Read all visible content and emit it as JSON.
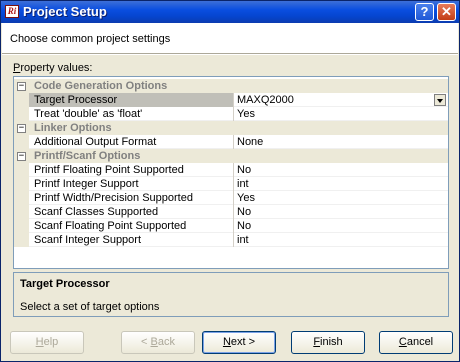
{
  "window": {
    "icon_text": "Ri",
    "title": "Project Setup",
    "help_glyph": "?",
    "close_glyph": "✕"
  },
  "subtitle": "Choose common project settings",
  "property_label": {
    "first": "P",
    "rest": "roperty values:"
  },
  "grid": {
    "categories": [
      {
        "name": "Code Generation Options",
        "toggle": "−",
        "props": [
          {
            "name": "Target Processor",
            "value": "MAXQ2000",
            "selected": true
          },
          {
            "name": "Treat 'double' as 'float'",
            "value": "Yes"
          }
        ]
      },
      {
        "name": "Linker Options",
        "toggle": "−",
        "props": [
          {
            "name": "Additional Output Format",
            "value": "None"
          }
        ]
      },
      {
        "name": "Printf/Scanf Options",
        "toggle": "−",
        "props": [
          {
            "name": "Printf Floating Point Supported",
            "value": "No"
          },
          {
            "name": "Printf Integer Support",
            "value": "int"
          },
          {
            "name": "Printf Width/Precision Supported",
            "value": "Yes"
          },
          {
            "name": "Scanf Classes Supported",
            "value": "No"
          },
          {
            "name": "Scanf Floating Point Supported",
            "value": "No"
          },
          {
            "name": "Scanf Integer Support",
            "value": "int"
          }
        ]
      }
    ]
  },
  "description": {
    "title": "Target Processor",
    "text": "Select a set of target options"
  },
  "buttons": {
    "help": {
      "mn": "H",
      "rest": "elp"
    },
    "back": {
      "pre": "< ",
      "mn": "B",
      "rest": "ack"
    },
    "next": {
      "mn": "N",
      "rest": "ext >"
    },
    "finish": {
      "mn": "F",
      "rest": "inish"
    },
    "cancel": {
      "mn": "C",
      "rest": "ancel"
    }
  }
}
